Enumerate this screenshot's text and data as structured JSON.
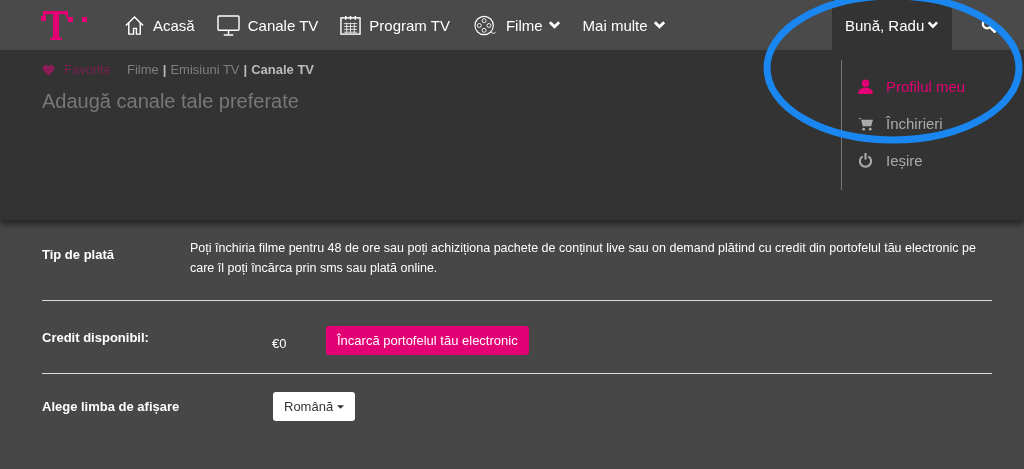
{
  "nav": {
    "items": [
      {
        "label": "Acasă",
        "dropdown": false
      },
      {
        "label": "Canale TV",
        "dropdown": false
      },
      {
        "label": "Program TV",
        "dropdown": false
      },
      {
        "label": "Filme",
        "dropdown": true
      },
      {
        "label": "Mai multe",
        "dropdown": true
      }
    ],
    "user": {
      "label": "Bună, Radu",
      "expanded": true
    }
  },
  "panel": {
    "favorite": "Favorite",
    "separator": "|",
    "breadcrumb": [
      {
        "label": "Filme",
        "selected": false
      },
      {
        "label": "Emisiuni TV",
        "selected": false
      },
      {
        "label": "Canale TV",
        "selected": true
      }
    ],
    "title": "Adaugă canale tale preferate",
    "user_menu": [
      {
        "label": "Profilul meu",
        "selected": true
      },
      {
        "label": "Închirieri",
        "selected": false
      },
      {
        "label": "Ieșire",
        "selected": false
      }
    ]
  },
  "account": {
    "rows": [
      {
        "kind": "text",
        "label": "Tip de plată",
        "value": "Poți închiria filme pentru 48 de ore sau poți achiziționa pachete de conținut live sau on demand plătind cu credit din portofelul tău electronic pe care îl poți încărca prin sms sau plată online."
      },
      {
        "kind": "credit",
        "label": "Credit disponibil:",
        "value": "€0",
        "button": "Încarcă portofelul tău electronic"
      },
      {
        "kind": "select",
        "label": "Alege limba de afișare",
        "value": "Română"
      }
    ]
  }
}
